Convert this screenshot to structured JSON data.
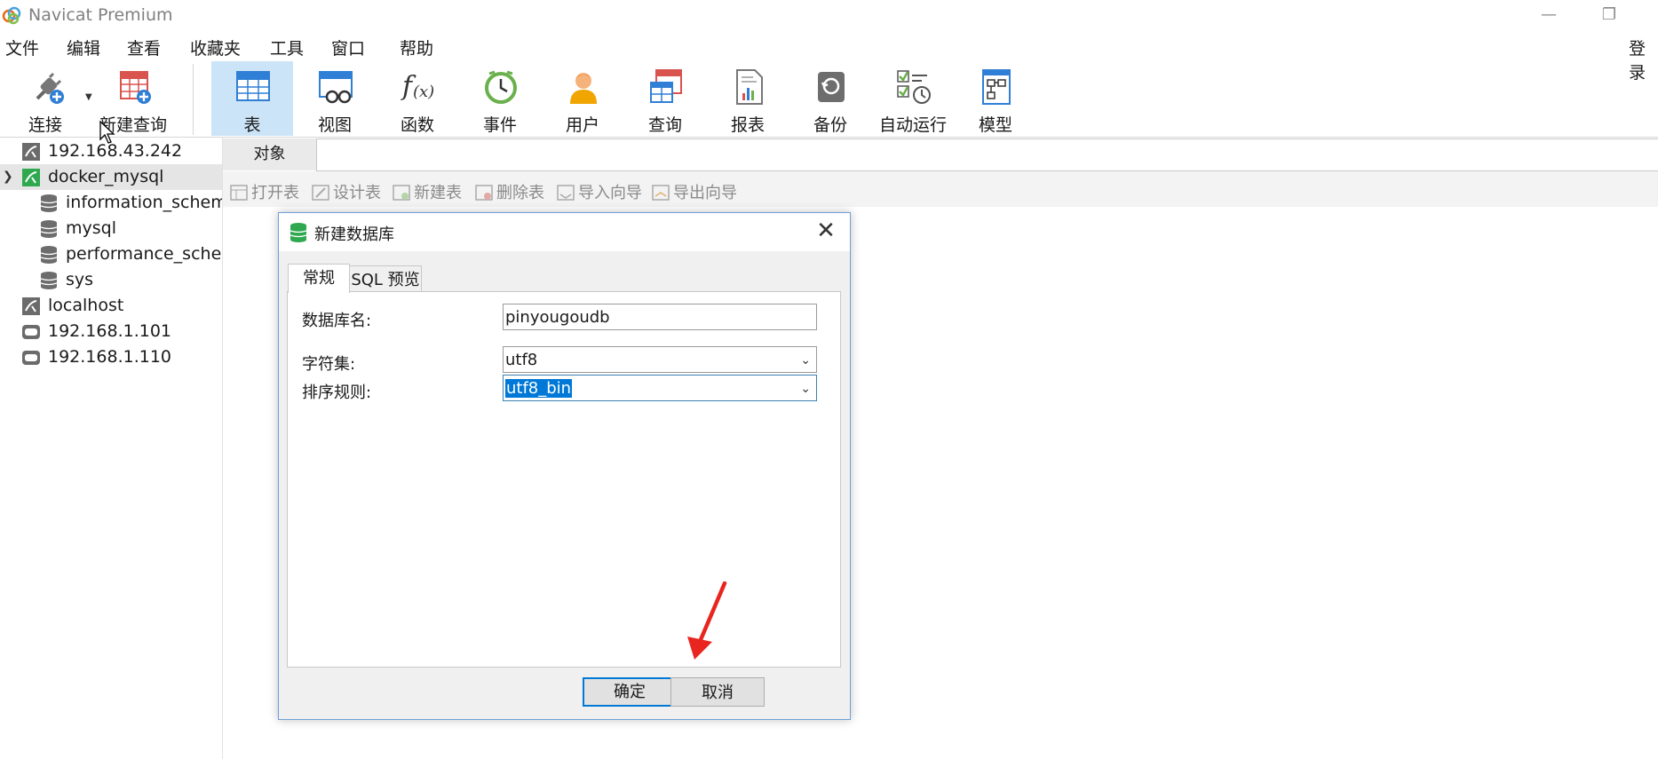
{
  "app": {
    "title": "Navicat Premium"
  },
  "menu": [
    "文件",
    "编辑",
    "查看",
    "收藏夹",
    "工具",
    "窗口",
    "帮助"
  ],
  "login": "登录",
  "toolbar": {
    "connect": "连接",
    "new_query": "新建查询",
    "items": [
      "表",
      "视图",
      "函数",
      "事件",
      "用户",
      "查询",
      "报表",
      "备份",
      "自动运行",
      "模型"
    ],
    "active": "表"
  },
  "sidebar": {
    "connections": [
      {
        "label": "192.168.43.242",
        "icon": "mysql-connection-icon"
      },
      {
        "label": "docker_mysql",
        "icon": "mysql-connection-active-icon",
        "expanded": true,
        "selected": true,
        "databases": [
          "information_schema",
          "mysql",
          "performance_schema",
          "sys"
        ]
      },
      {
        "label": "localhost",
        "icon": "mysql-connection-icon"
      },
      {
        "label": "192.168.1.101",
        "icon": "server-icon"
      },
      {
        "label": "192.168.1.110",
        "icon": "server-icon"
      }
    ]
  },
  "content": {
    "tab": "对象",
    "actions": [
      "打开表",
      "设计表",
      "新建表",
      "删除表",
      "导入向导",
      "导出向导"
    ]
  },
  "dialog": {
    "title": "新建数据库",
    "tabs": [
      "常规",
      "SQL 预览"
    ],
    "fields": {
      "dbname_label": "数据库名:",
      "dbname_value": "pinyougoudb",
      "charset_label": "字符集:",
      "charset_value": "utf8",
      "collation_label": "排序规则:",
      "collation_value": "utf8_bin"
    },
    "ok": "确定",
    "cancel": "取消"
  },
  "colors": {
    "accent": "#0078d7",
    "annotation_arrow": "#e8261f",
    "toolbar_active": "#cce4f7"
  }
}
